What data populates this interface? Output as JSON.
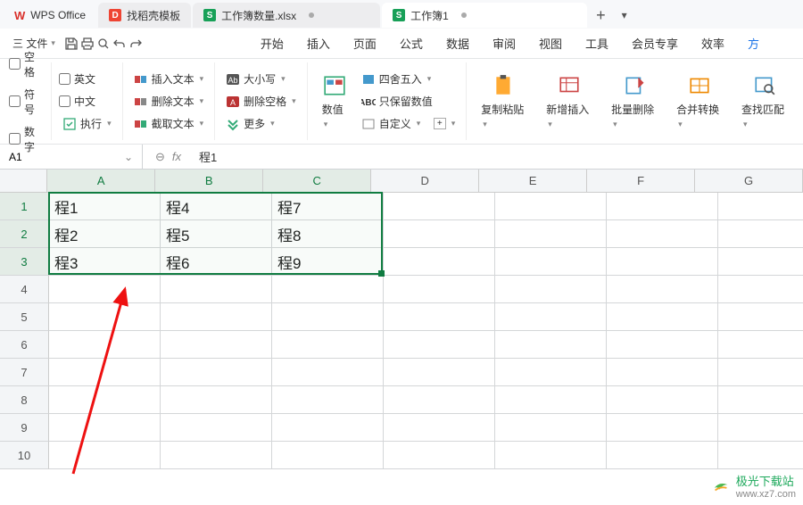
{
  "app": {
    "name": "WPS Office"
  },
  "tabs": [
    {
      "label": "找稻壳模板",
      "iconText": "D"
    },
    {
      "label": "工作簿数量.xlsx",
      "iconText": "S"
    },
    {
      "label": "工作簿1",
      "iconText": "S",
      "active": true
    }
  ],
  "quickAccess": {
    "file": "三 文件"
  },
  "menu": [
    "开始",
    "插入",
    "页面",
    "公式",
    "数据",
    "审阅",
    "视图",
    "工具",
    "会员专享",
    "效率",
    "方"
  ],
  "ribbon": {
    "checks1": [
      "空格",
      "符号",
      "数字"
    ],
    "checks2": [
      "英文",
      "中文"
    ],
    "execute": "执行",
    "textOps": [
      "插入文本",
      "删除文本",
      "截取文本"
    ],
    "caseOps": [
      "大小写",
      "删除空格",
      "更多"
    ],
    "numOps": "数值",
    "numSide": [
      "四舍五入",
      "只保留数值",
      "自定义"
    ],
    "bigBtns": [
      "复制粘贴",
      "新增插入",
      "批量删除",
      "合并转换",
      "查找匹配"
    ]
  },
  "formulaBar": {
    "name": "A1",
    "value": "程1",
    "fx": "fx"
  },
  "grid": {
    "cols": [
      "A",
      "B",
      "C",
      "D",
      "E",
      "F",
      "G"
    ],
    "rows": [
      "1",
      "2",
      "3",
      "4",
      "5",
      "6",
      "7",
      "8",
      "9",
      "10"
    ],
    "data": [
      [
        "程1",
        "程4",
        "程7"
      ],
      [
        "程2",
        "程5",
        "程8"
      ],
      [
        "程3",
        "程6",
        "程9"
      ]
    ],
    "selection": {
      "top": 0,
      "left": 0,
      "rows": 3,
      "cols": 3
    }
  },
  "watermark": {
    "title": "极光下载站",
    "url": "www.xz7.com"
  }
}
